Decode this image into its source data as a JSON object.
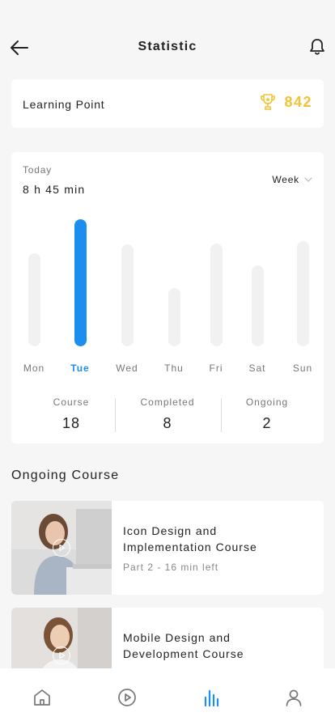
{
  "header": {
    "title": "Statistic",
    "back_icon": "arrow-left-icon",
    "bell_icon": "bell-icon"
  },
  "learning_point": {
    "label": "Learning Point",
    "value": "842",
    "icon": "trophy-icon",
    "color": "#f2c335"
  },
  "stats": {
    "today_label": "Today",
    "today_value": "8 h 45 min",
    "period_label": "Week",
    "active_day_index": 1,
    "accent": "#1a8ff0"
  },
  "chart_data": {
    "type": "bar",
    "categories": [
      "Mon",
      "Tue",
      "Wed",
      "Thu",
      "Fri",
      "Sat",
      "Sun"
    ],
    "values": [
      0.73,
      1.0,
      0.8,
      0.46,
      0.81,
      0.64,
      0.83
    ],
    "ylim": [
      0,
      1
    ],
    "highlighted_category": "Tue",
    "grid": false
  },
  "summary": [
    {
      "label": "Course",
      "value": "18"
    },
    {
      "label": "Completed",
      "value": "8"
    },
    {
      "label": "Ongoing",
      "value": "2"
    }
  ],
  "ongoing": {
    "title": "Ongoing Course",
    "courses": [
      {
        "title_line1": "Icon Design and",
        "title_line2": "Implementation Course",
        "subtitle": "Part 2 - 16 min left",
        "play_icon": "play-circle-icon"
      },
      {
        "title_line1": "Mobile Design and",
        "title_line2": "Development Course",
        "subtitle": "",
        "play_icon": "play-circle-icon"
      }
    ]
  },
  "tabbar": {
    "tabs": [
      {
        "icon": "home-icon",
        "active": false
      },
      {
        "icon": "play-circle-icon",
        "active": false
      },
      {
        "icon": "bar-chart-icon",
        "active": true
      },
      {
        "icon": "user-icon",
        "active": false
      }
    ]
  }
}
